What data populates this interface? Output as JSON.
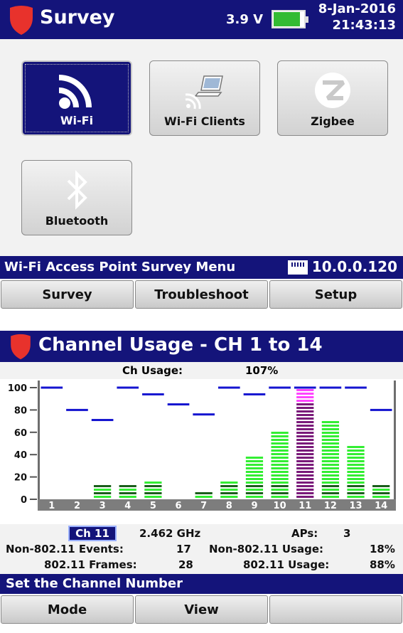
{
  "survey_screen": {
    "title": "Survey",
    "voltage": "3.9 V",
    "date": "8-Jan-2016",
    "time": "21:43:13",
    "battery_level": 0.8,
    "tiles": [
      {
        "label": "Wi-Fi",
        "icon": "wifi-icon",
        "selected": true
      },
      {
        "label": "Wi-Fi Clients",
        "icon": "laptop-wifi-icon",
        "selected": false
      },
      {
        "label": "Zigbee",
        "icon": "zigbee-icon",
        "selected": false
      },
      {
        "label": "Bluetooth",
        "icon": "bluetooth-icon",
        "selected": false
      }
    ],
    "status_text": "Wi-Fi Access Point Survey Menu",
    "ip_address": "10.0.0.120",
    "softkeys": [
      "Survey",
      "Troubleshoot",
      "Setup"
    ]
  },
  "channel_screen": {
    "title": "Channel Usage - CH 1 to 14",
    "usage_label": "Ch Usage:",
    "usage_value": "107%",
    "channel_select": "Ch 11",
    "frequency": "2.462 GHz",
    "aps_label": "APs:",
    "aps_value": "3",
    "non80211_events_label": "Non-802.11 Events:",
    "non80211_events_value": "17",
    "non80211_usage_label": "Non-802.11 Usage:",
    "non80211_usage_value": "18%",
    "frames_label": "802.11 Frames:",
    "frames_value": "28",
    "usage80211_label": "802.11 Usage:",
    "usage80211_value": "88%",
    "status_text": "Set the Channel Number",
    "softkeys": [
      "Mode",
      "View",
      ""
    ]
  },
  "colors": {
    "navy": "#14147a",
    "bar_green": "#33ee33",
    "bar_dark": "#1a5e1a",
    "bar_selected": "#7a1a7a",
    "bar_selected_top": "#ff44ff",
    "peak": "#1414d0"
  },
  "chart_data": {
    "type": "bar",
    "categories": [
      "1",
      "2",
      "3",
      "4",
      "5",
      "6",
      "7",
      "8",
      "9",
      "10",
      "11",
      "12",
      "13",
      "14"
    ],
    "ylim": [
      0,
      100
    ],
    "yticks": [
      "100",
      "80",
      "60",
      "40",
      "20",
      "0"
    ],
    "series": [
      {
        "name": "",
        "values": [
          0,
          0,
          13,
          13,
          17,
          0,
          8,
          17,
          40,
          63,
          100,
          72,
          50,
          13
        ]
      },
      {
        "name": "",
        "values": [
          100,
          80,
          71,
          100,
          94,
          85,
          76,
          100,
          94,
          100,
          100,
          100,
          100,
          80
        ]
      }
    ],
    "selected_category": "11"
  }
}
